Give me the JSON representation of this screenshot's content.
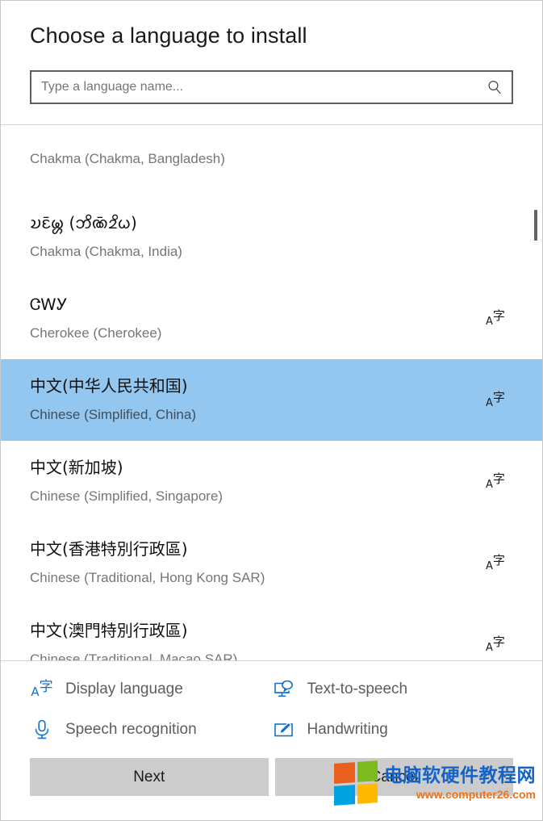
{
  "dialog": {
    "title": "Choose a language to install"
  },
  "search": {
    "placeholder": "Type a language name...",
    "value": "",
    "icon": "search-icon"
  },
  "list": {
    "scroll_position": "near-top",
    "items": [
      {
        "native": "",
        "english": "Chakma (Chakma, Bangladesh)",
        "icons": [],
        "selected": false,
        "clipped": "top"
      },
      {
        "native": "𑄌𑄋𑄴𑄟𑄳𑄦 (𑄃𑄨𑄚𑄴𑄓𑄨𑄠)",
        "english": "Chakma (Chakma, India)",
        "icons": [],
        "selected": false
      },
      {
        "native": "ᏣᎳᎩ",
        "english": "Cherokee (Cherokee)",
        "icons": [
          "display-language"
        ],
        "selected": false
      },
      {
        "native": "中文(中华人民共和国)",
        "english": "Chinese (Simplified, China)",
        "icons": [
          "display-language"
        ],
        "selected": true
      },
      {
        "native": "中文(新加坡)",
        "english": "Chinese (Simplified, Singapore)",
        "icons": [
          "display-language"
        ],
        "selected": false
      },
      {
        "native": "中文(香港特別行政區)",
        "english": "Chinese (Traditional, Hong Kong SAR)",
        "icons": [
          "display-language"
        ],
        "selected": false
      },
      {
        "native": "中文(澳門特別行政區)",
        "english": "Chinese (Traditional, Macao SAR)",
        "icons": [
          "display-language"
        ],
        "selected": false,
        "clipped": "bottom"
      }
    ]
  },
  "legend": {
    "items": [
      {
        "label": "Display language",
        "icon": "display-language-icon"
      },
      {
        "label": "Text-to-speech",
        "icon": "text-to-speech-icon"
      },
      {
        "label": "Speech recognition",
        "icon": "microphone-icon"
      },
      {
        "label": "Handwriting",
        "icon": "handwriting-pen-icon"
      }
    ]
  },
  "buttons": {
    "next": "Next",
    "cancel": "Cancel"
  },
  "watermark": {
    "site_name": "电脑软硬件教程网",
    "url": "www.computer26.com",
    "colors": [
      "#e8601c",
      "#7cba1e",
      "#00a3e0",
      "#ffb900"
    ]
  },
  "colors": {
    "selection": "#93c7ef",
    "accent_blue": "#1472c8",
    "button_bg": "#cccccc",
    "secondary_text": "#767676"
  }
}
